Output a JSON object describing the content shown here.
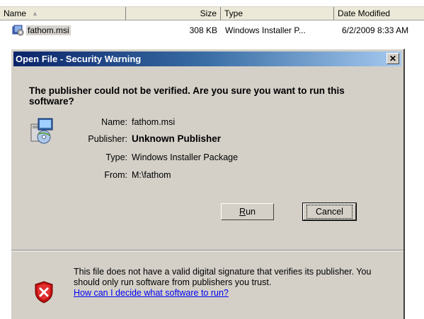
{
  "list": {
    "columns": [
      {
        "label": "Name"
      },
      {
        "label": "Size"
      },
      {
        "label": "Type"
      },
      {
        "label": "Date Modified"
      }
    ],
    "rows": [
      {
        "name": "fathom.msi",
        "size": "308 KB",
        "type": "Windows Installer P...",
        "date": "6/2/2009 8:33 AM"
      }
    ]
  },
  "dialog": {
    "title": "Open File - Security Warning",
    "close_glyph": "✕",
    "question": "The publisher could not be verified.  Are you sure you want to run this software?",
    "details": {
      "name_label": "Name:",
      "name_value": "fathom.msi",
      "publisher_label": "Publisher:",
      "publisher_value": "Unknown Publisher",
      "type_label": "Type:",
      "type_value": "Windows Installer Package",
      "from_label": "From:",
      "from_value": "M:\\fathom"
    },
    "run_label": "Run",
    "run_accelerator": "R",
    "cancel_label": "Cancel",
    "warning_text": "This file does not have a valid digital signature that verifies its publisher.  You should only run software from publishers you trust.",
    "warning_link": "How can I decide what software to run?"
  },
  "colors": {
    "title_gradient_start": "#0a246a",
    "title_gradient_end": "#a6caf0",
    "dialog_bg": "#d4d0c8",
    "link": "#0000ee"
  },
  "icons": {
    "package": "installer-package-icon",
    "shield": "security-shield-icon",
    "file": "msi-file-icon",
    "sort": "sort-ascending-icon"
  }
}
